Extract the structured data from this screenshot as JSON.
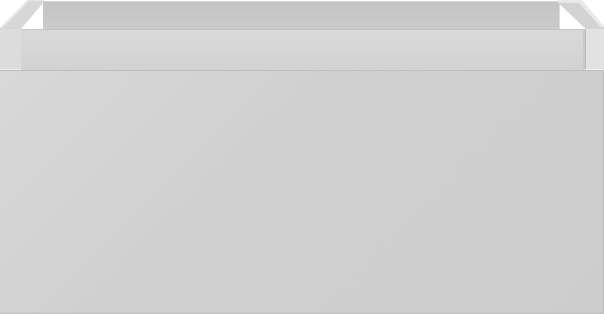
{
  "image": {
    "subject": "",
    "colors": {
      "panel": "#d0d0d0",
      "rim": "#d6d6d6",
      "interior": "#c7c7c7",
      "background": "#ffffff"
    }
  }
}
